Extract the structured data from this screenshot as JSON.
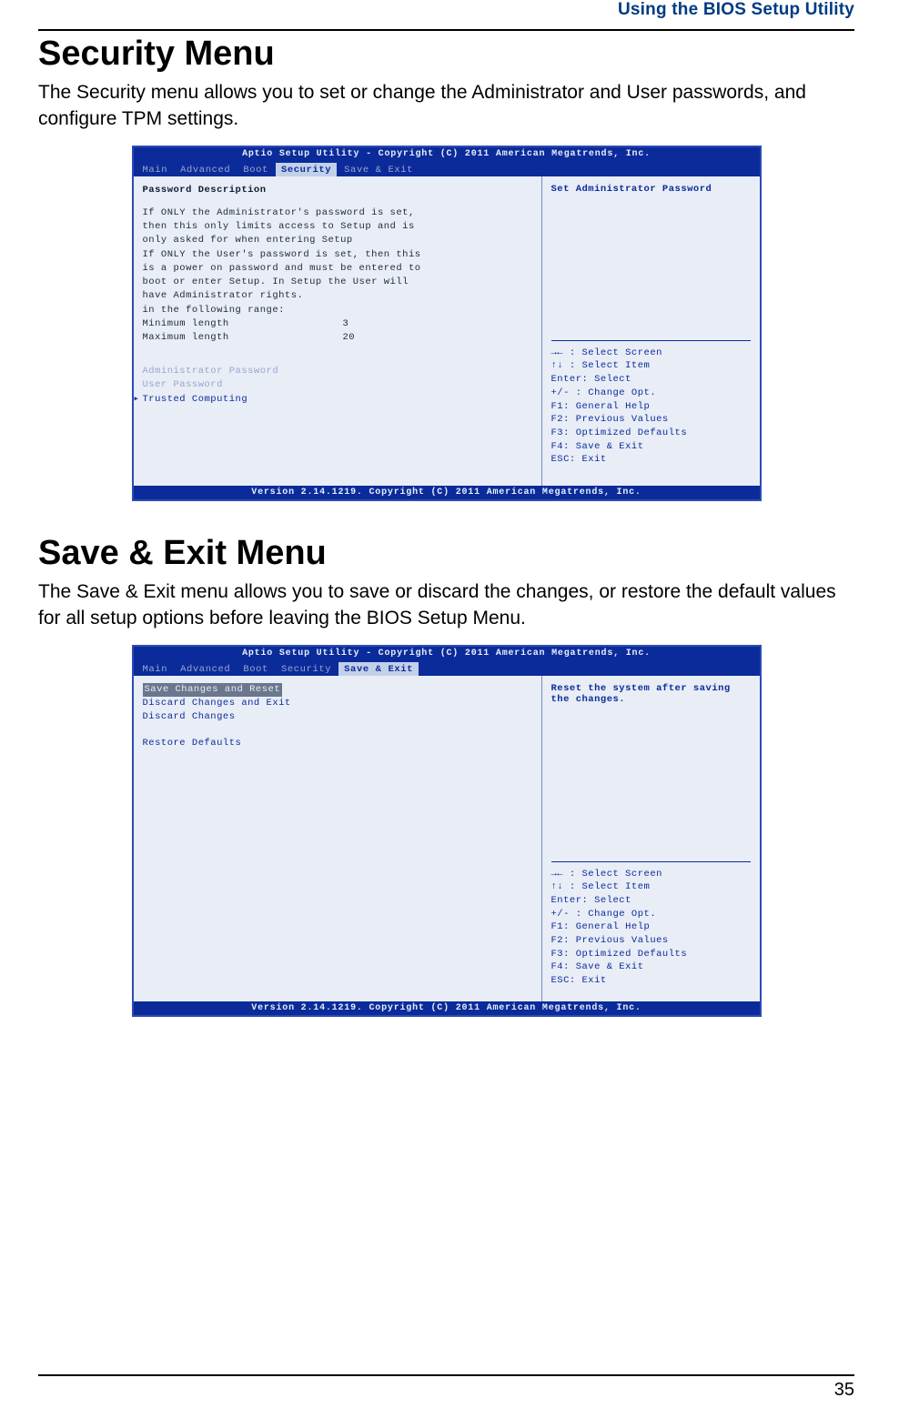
{
  "header": {
    "section": "Using the BIOS Setup Utility"
  },
  "security": {
    "title": "Security Menu",
    "desc": "The Security menu allows you to set or change the Administrator and User passwords, and configure TPM settings."
  },
  "saveexit": {
    "title": "Save & Exit Menu",
    "desc": "The Save & Exit menu allows you to save or discard the changes, or restore the default values for all setup options before leaving the BIOS Setup Menu."
  },
  "bios_common": {
    "titlebar": "Aptio Setup Utility - Copyright (C) 2011 American Megatrends, Inc.",
    "footer": "Version 2.14.1219. Copyright (C) 2011 American Megatrends, Inc.",
    "tabs": {
      "main": "Main",
      "advanced": "Advanced",
      "boot": "Boot",
      "security": "Security",
      "saveexit": "Save & Exit"
    },
    "help": {
      "select_screen": "→← : Select Screen",
      "select_item": "↑↓ : Select Item",
      "enter": "Enter: Select",
      "change": "+/- : Change Opt.",
      "f1": "F1: General Help",
      "f2": "F2: Previous Values",
      "f3": "F3: Optimized Defaults",
      "f4": "F4: Save & Exit",
      "esc": "ESC: Exit"
    }
  },
  "bios1": {
    "left": {
      "heading": "Password Description",
      "lines": [
        "If ONLY the Administrator's password is set,",
        "then this only limits access to Setup and is",
        "only asked for when entering Setup",
        "If ONLY the User's password is set, then this",
        "is a power on password and must be entered to",
        "boot or enter Setup. In Setup the User will",
        "have Administrator rights.",
        "in the following range:"
      ],
      "min_label": "Minimum length",
      "min_val": "3",
      "max_label": "Maximum length",
      "max_val": "20",
      "admin_pw": "Administrator Password",
      "user_pw": "User Password",
      "trusted": "Trusted Computing"
    },
    "right_title": "Set Administrator Password"
  },
  "bios2": {
    "left": {
      "save_reset": "Save Changes and Reset",
      "discard_exit": "Discard Changes and Exit",
      "discard": "Discard Changes",
      "restore": "Restore Defaults"
    },
    "right_title1": "Reset the system after saving",
    "right_title2": "the changes."
  },
  "page_number": "35"
}
